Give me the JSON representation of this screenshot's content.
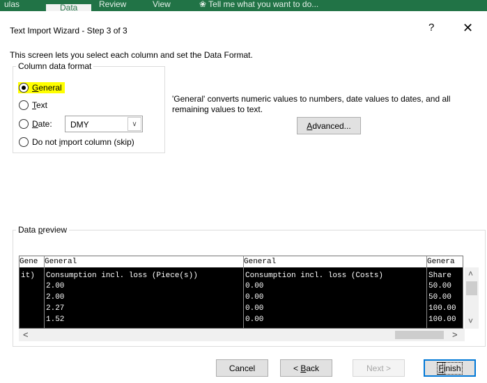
{
  "ribbon": {
    "tabs": [
      "ulas",
      "Data",
      "Review",
      "View"
    ],
    "tell_me": "❀ Tell me what you want to do..."
  },
  "dialog": {
    "title": "Text Import Wizard - Step 3 of 3",
    "help": "?",
    "close": "✕",
    "intro": "This screen lets you select each column and set the Data Format."
  },
  "format": {
    "legend": "Column data format",
    "general": {
      "pre": "",
      "ul": "G",
      "post": "eneral",
      "checked": true
    },
    "text": {
      "pre": "",
      "ul": "T",
      "post": "ext",
      "checked": false
    },
    "date": {
      "pre": "",
      "ul": "D",
      "post": "ate:",
      "checked": false,
      "value": "DMY"
    },
    "skip": {
      "pre": "Do not ",
      "ul": "i",
      "post": "mport column (skip)",
      "checked": false
    },
    "description": "'General' converts numeric values to numbers, date values to dates, and all remaining values to text.",
    "advanced": {
      "ul": "A",
      "post": "dvanced..."
    }
  },
  "preview": {
    "legend_ul": "p",
    "legend_pre": "Data ",
    "legend_post": "review",
    "headers": [
      "Gene",
      "General",
      "General",
      "Genera"
    ],
    "rows": [
      [
        "it)",
        "Consumption incl. loss (Piece(s))",
        "Consumption incl. loss (Costs)",
        "Share"
      ],
      [
        "",
        "2.00",
        "0.00",
        "50.00"
      ],
      [
        "",
        "2.00",
        "0.00",
        "50.00"
      ],
      [
        "",
        "2.27",
        "0.00",
        "100.00"
      ],
      [
        "",
        "1.52",
        "0.00",
        "100.00"
      ]
    ]
  },
  "scroll": {
    "up": "˄",
    "down": "˅",
    "left": "<",
    "right": ">"
  },
  "buttons": {
    "cancel": "Cancel",
    "back": {
      "pre": "< ",
      "ul": "B",
      "post": "ack"
    },
    "next": "Next >",
    "finish": {
      "ul": "F",
      "post": "inish"
    }
  },
  "select_arrow": "∨"
}
